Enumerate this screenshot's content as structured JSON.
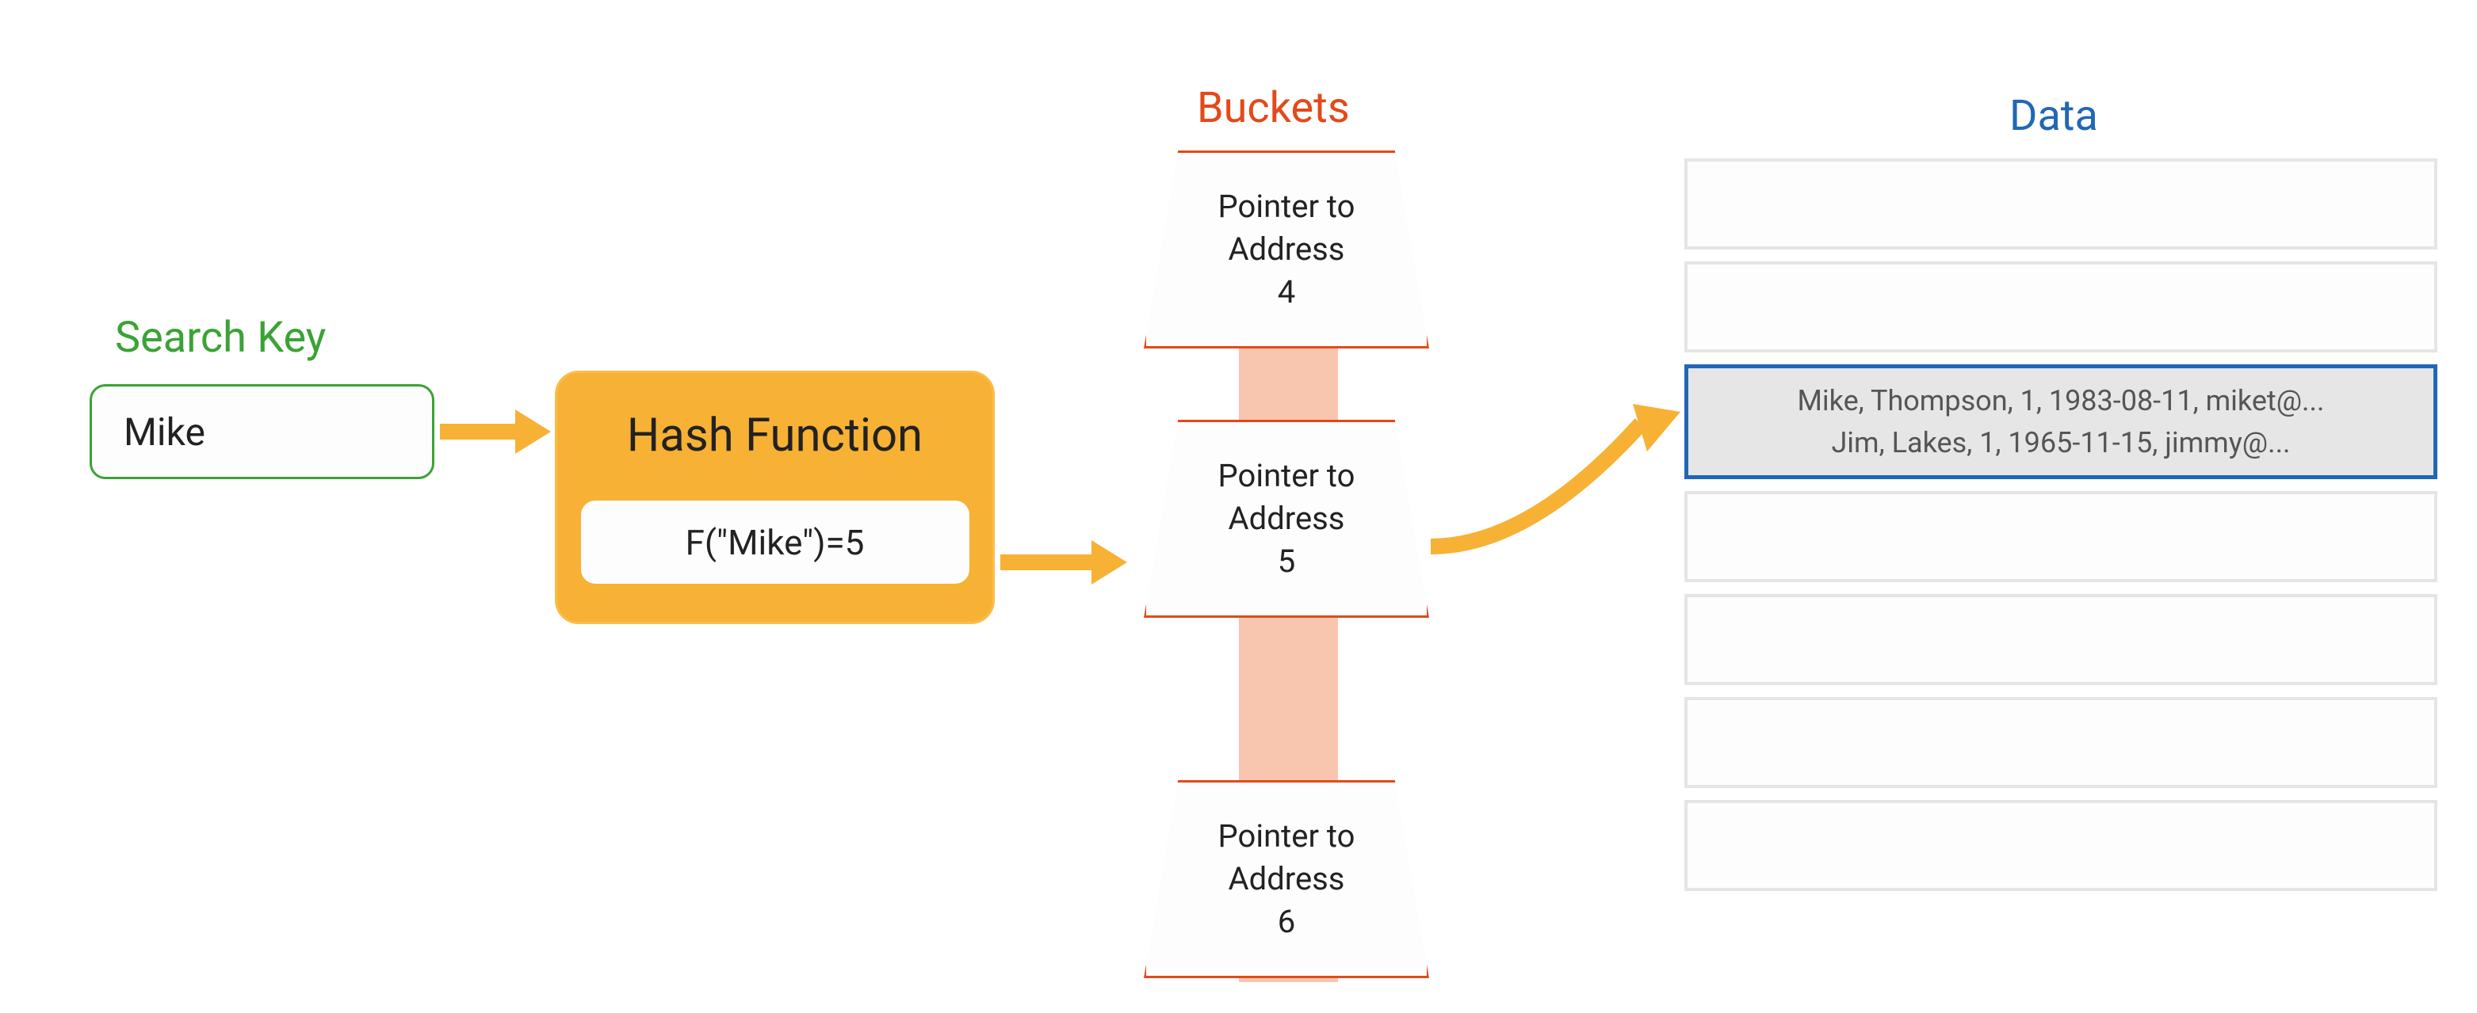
{
  "search_key": {
    "label": "Search Key",
    "value": "Mike"
  },
  "hash_function": {
    "title": "Hash Function",
    "result": "F(\"Mike\")=5"
  },
  "buckets": {
    "label": "Buckets",
    "items": [
      {
        "line1": "Pointer to",
        "line2": "Address",
        "line3": "4"
      },
      {
        "line1": "Pointer to",
        "line2": "Address",
        "line3": "5"
      },
      {
        "line1": "Pointer to",
        "line2": "Address",
        "line3": "6"
      }
    ]
  },
  "data": {
    "label": "Data",
    "highlighted_rows": [
      "Mike, Thompson, 1, 1983-08-11, miket@...",
      "Jim, Lakes, 1, 1965-11-15, jimmy@..."
    ]
  },
  "colors": {
    "green": "#3aa335",
    "orange": "#f7b135",
    "red_orange": "#e34919",
    "blue": "#2167b5",
    "light_orange": "#f8c5ae",
    "grey_border": "#e5e5e5",
    "grey_bg": "#e6e6e6"
  }
}
